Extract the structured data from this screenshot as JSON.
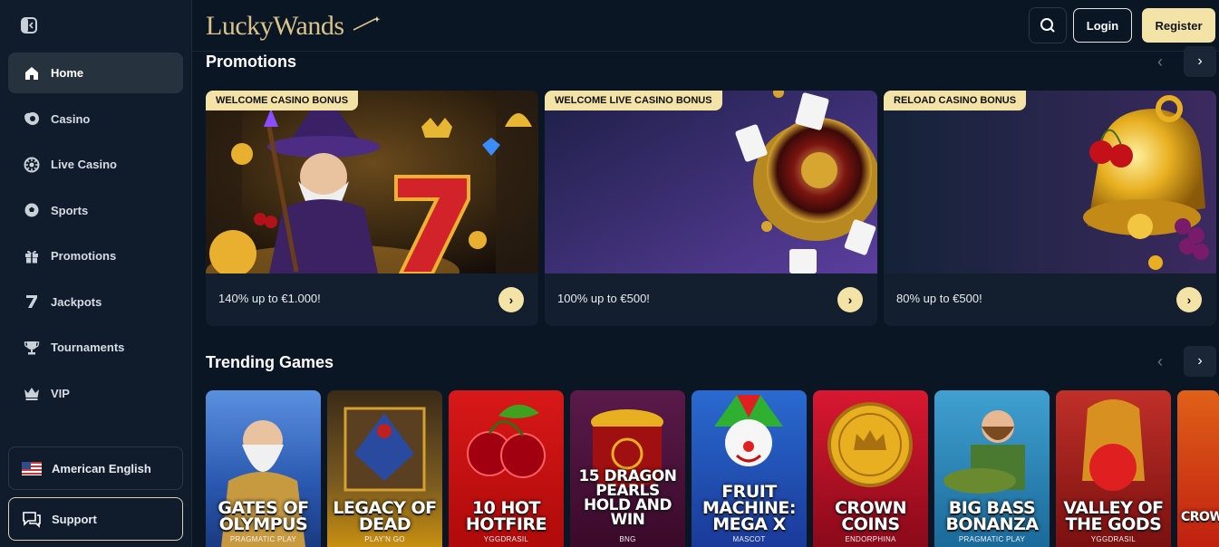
{
  "header": {
    "logo_text": "LuckyWands",
    "login_label": "Login",
    "register_label": "Register"
  },
  "sidebar": {
    "items": [
      {
        "label": "Home",
        "icon": "home-icon"
      },
      {
        "label": "Casino",
        "icon": "casino-chip-icon"
      },
      {
        "label": "Live Casino",
        "icon": "roulette-icon"
      },
      {
        "label": "Sports",
        "icon": "soccer-ball-icon"
      },
      {
        "label": "Promotions",
        "icon": "gift-icon"
      },
      {
        "label": "Jackpots",
        "icon": "seven-icon"
      },
      {
        "label": "Tournaments",
        "icon": "trophy-icon"
      },
      {
        "label": "VIP",
        "icon": "crown-icon"
      }
    ],
    "language_label": "American English",
    "support_label": "Support"
  },
  "promotions": {
    "title": "Promotions",
    "cards": [
      {
        "tag": "WELCOME CASINO BONUS",
        "text": "140% up to €1.000!"
      },
      {
        "tag": "WELCOME LIVE CASINO BONUS",
        "text": "100% up to €500!"
      },
      {
        "tag": "RELOAD CASINO BONUS",
        "text": "80% up to €500!"
      }
    ]
  },
  "trending": {
    "title": "Trending Games",
    "games": [
      {
        "title": "GATES OF OLYMPUS",
        "provider": "PRAGMATIC PLAY"
      },
      {
        "title": "LEGACY OF DEAD",
        "provider": "PLAY'N GO"
      },
      {
        "title": "10 HOT HOTFIRE",
        "provider": "YGGDRASIL"
      },
      {
        "title": "15 DRAGON PEARLS HOLD AND WIN",
        "provider": "BNG"
      },
      {
        "title": "FRUIT MACHINE: MEGA X",
        "provider": "MASCOT"
      },
      {
        "title": "CROWN COINS",
        "provider": "ENDORPHINA"
      },
      {
        "title": "BIG BASS BONANZA",
        "provider": "PRAGMATIC PLAY"
      },
      {
        "title": "VALLEY OF THE GODS",
        "provider": "YGGDRASIL"
      },
      {
        "title": "CROWN HOLD",
        "provider": ""
      }
    ]
  },
  "colors": {
    "accent": "#f4e3a6",
    "background": "#0b1624",
    "sidebar": "#101c2b"
  }
}
